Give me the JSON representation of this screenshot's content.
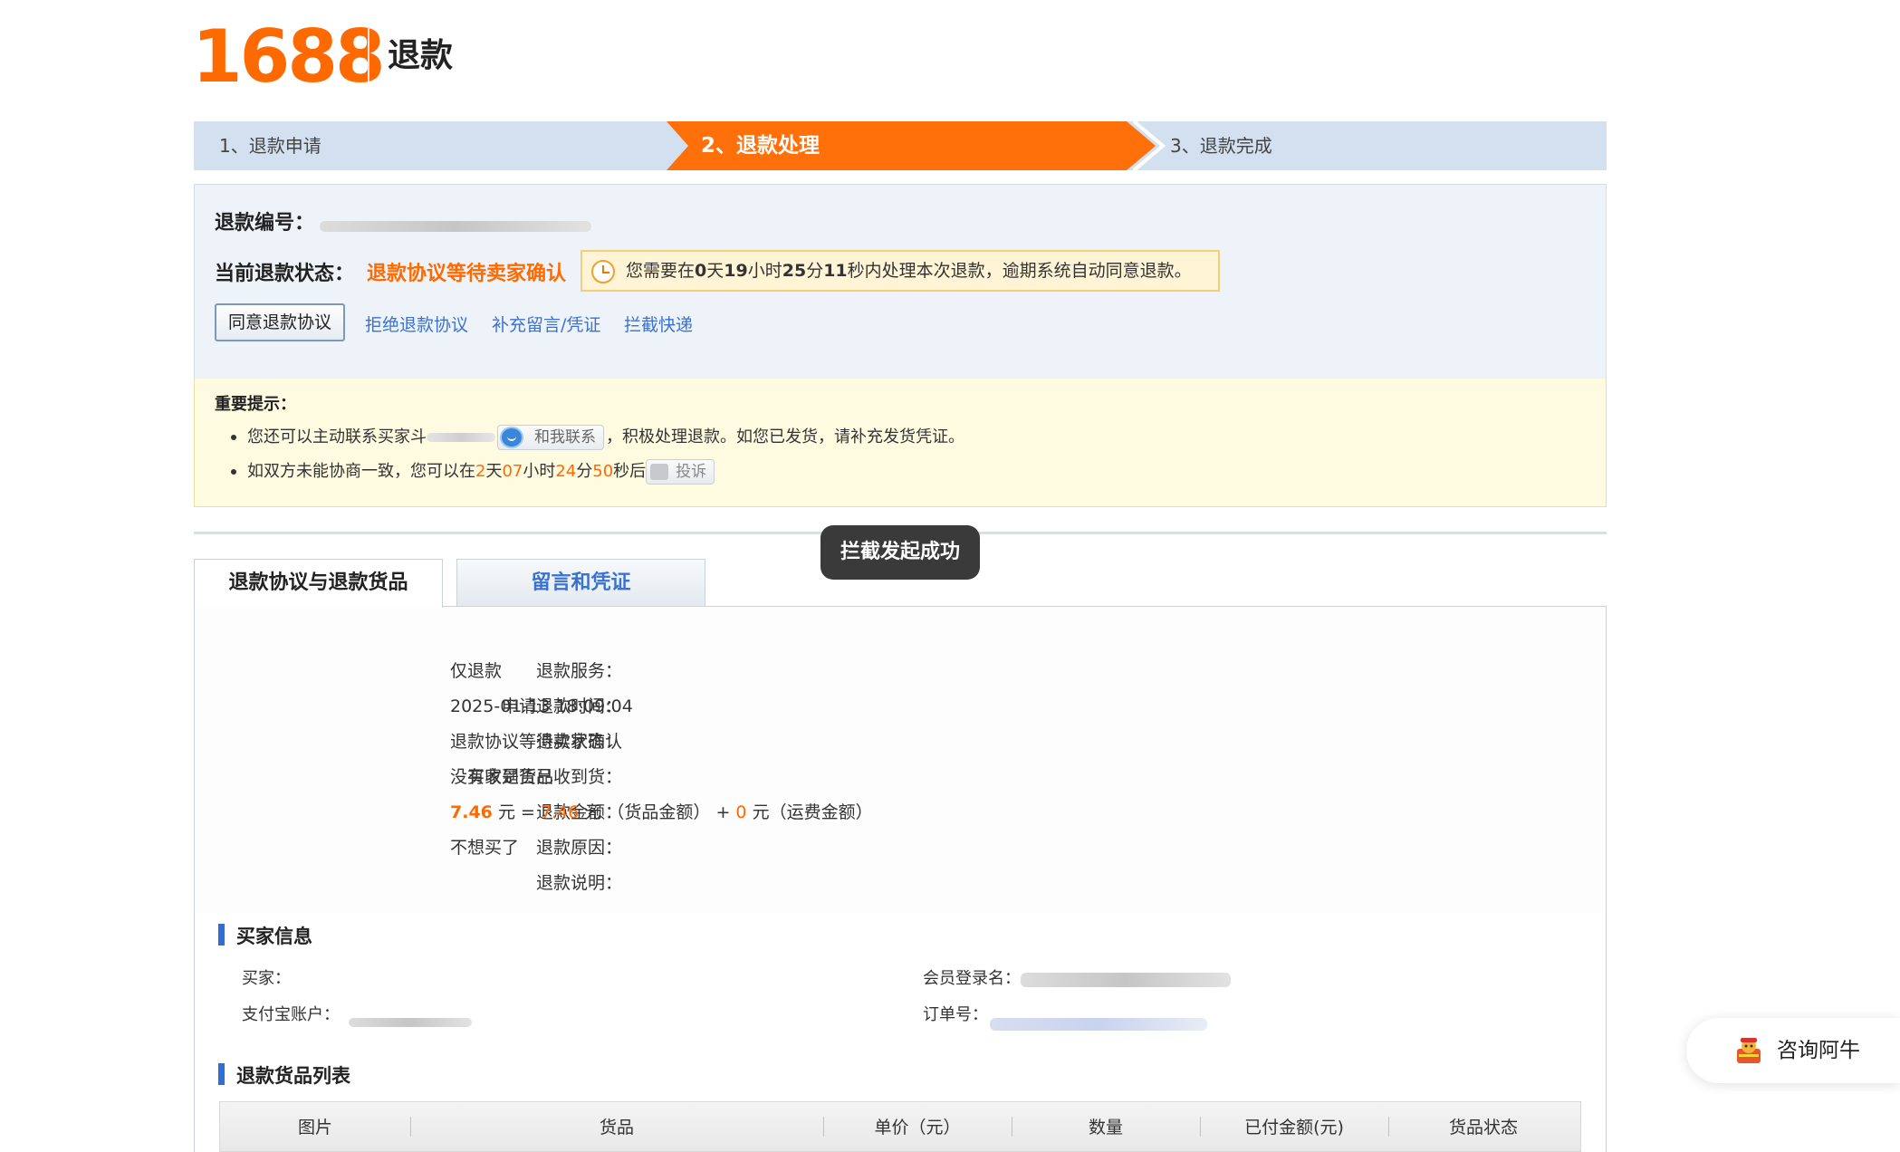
{
  "header": {
    "logo": "1688",
    "title": "退款"
  },
  "steps": [
    {
      "label": "1、退款申请"
    },
    {
      "label": "2、退款处理"
    },
    {
      "label": "3、退款完成"
    }
  ],
  "status": {
    "refund_no_label": "退款编号：",
    "state_label": "当前退款状态：",
    "state_value": "退款协议等待卖家确认",
    "timer": {
      "prefix": "您需要在",
      "days": "0",
      "days_unit": "天",
      "hours": "19",
      "hours_unit": "小时",
      "minutes": "25",
      "minutes_unit": "分",
      "seconds": "11",
      "suffix": "秒内处理本次退款，逾期系统自动同意退款。"
    },
    "agree_button": "同意退款协议",
    "actions": [
      "拒绝退款协议",
      "补充留言/凭证",
      "拦截快递"
    ]
  },
  "notice": {
    "title": "重要提示：",
    "line1_prefix": "您还可以主动联系买家",
    "line1_buyer_initial": "斗",
    "contact_button": "和我联系",
    "line1_suffix": "，积极处理退款。如您已发货，请补充发货凭证。",
    "line2_prefix": "如双方未能协商一致，您可以在",
    "days": "2",
    "days_unit": "天",
    "hours": "07",
    "hours_unit": "小时",
    "minutes": "24",
    "minutes_unit": "分",
    "seconds": "50",
    "seconds_unit": "秒后",
    "complain_button": "投诉"
  },
  "toast": "拦截发起成功",
  "tabs": [
    "退款协议与退款货品",
    "留言和凭证"
  ],
  "details": {
    "service_label": "退款服务：",
    "service_value": "仅退款",
    "time_label": "申请退款时间：",
    "time_value": "2025-01-13 18:09:04",
    "state_label": "退款状态：",
    "state_value": "退款协议等待卖家确认",
    "received_label": "买家是否已收到货：",
    "received_value": "没有收到货品",
    "amount_label": "退款金额：",
    "amount_total": "7.46",
    "amount_unit": "元",
    "amount_eq": "=",
    "amount_goods": "7.46",
    "amount_goods_note": "（货品金额）",
    "amount_plus": "+",
    "amount_freight": "0",
    "amount_freight_note": "（运费金额）",
    "reason_label": "退款原因：",
    "reason_value": "不想买了",
    "desc_label": "退款说明："
  },
  "buyer": {
    "title": "买家信息",
    "buyer_label": "买家：",
    "member_label": "会员登录名：",
    "alipay_label": "支付宝账户：",
    "order_label": "订单号："
  },
  "goods": {
    "title": "退款货品列表",
    "columns": [
      "图片",
      "货品",
      "单价（元）",
      "数量",
      "已付金额(元)",
      "货品状态"
    ]
  },
  "consult": {
    "label": "咨询阿牛"
  },
  "colors": {
    "accent": "#ff6a00",
    "link": "#3a72d0",
    "step_bg": "#d3e0ef"
  }
}
